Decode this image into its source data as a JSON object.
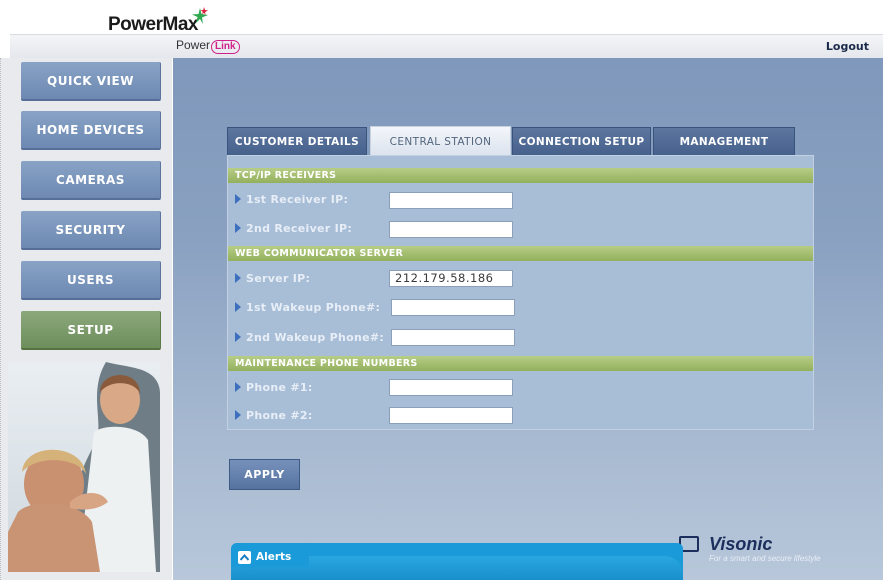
{
  "brand": {
    "product": "PowerMax",
    "sub_prefix": "Power",
    "sub_suffix": "Link"
  },
  "header": {
    "logout_label": "Logout"
  },
  "nav": {
    "items": [
      {
        "label": "QUICK VIEW"
      },
      {
        "label": "HOME DEVICES"
      },
      {
        "label": "CAMERAS"
      },
      {
        "label": "SECURITY"
      },
      {
        "label": "USERS"
      },
      {
        "label": "SETUP",
        "active": true
      }
    ]
  },
  "tabs": [
    {
      "label": "CUSTOMER DETAILS"
    },
    {
      "label": "CENTRAL STATION",
      "active": true
    },
    {
      "label": "CONNECTION SETUP"
    },
    {
      "label": "MANAGEMENT"
    }
  ],
  "form": {
    "sections": [
      {
        "title": "TCP/IP RECEIVERS",
        "rows": [
          {
            "label": "1st Receiver IP:",
            "value": ""
          },
          {
            "label": "2nd Receiver IP:",
            "value": ""
          }
        ]
      },
      {
        "title": "WEB COMMUNICATOR SERVER",
        "rows": [
          {
            "label": "Server IP:",
            "value": "212.179.58.186"
          },
          {
            "label": "1st Wakeup Phone#:",
            "value": ""
          },
          {
            "label": "2nd Wakeup Phone#:",
            "value": ""
          }
        ]
      },
      {
        "title": "MAINTENANCE PHONE NUMBERS",
        "rows": [
          {
            "label": "Phone #1:",
            "value": ""
          },
          {
            "label": "Phone #2:",
            "value": ""
          }
        ]
      }
    ]
  },
  "actions": {
    "apply_label": "APPLY"
  },
  "footer": {
    "vendor": "Visonic",
    "slogan": "For a smart and secure lifestyle",
    "alerts_label": "Alerts"
  },
  "colors": {
    "nav_button": "#7c97bd",
    "nav_active": "#7e9c6c",
    "section_header": "#a5bf72",
    "main_background": "#8aa1c1",
    "alerts_bar": "#1a9ad8"
  }
}
